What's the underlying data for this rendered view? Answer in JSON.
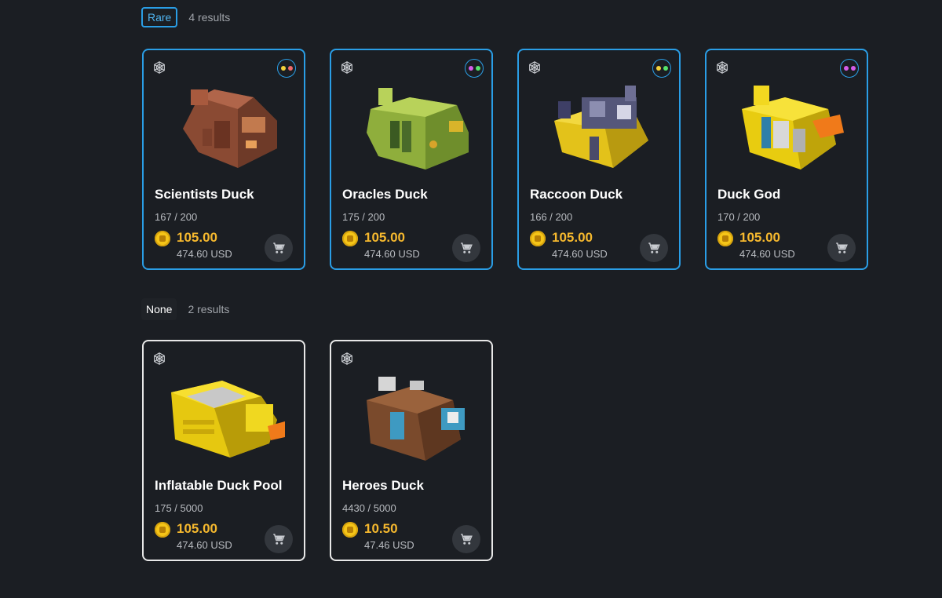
{
  "sections": [
    {
      "tag": "Rare",
      "count": "4 results",
      "cards": [
        {
          "name": "Scientists Duck",
          "supply": "167 / 200",
          "price": "105.00",
          "usd": "474.60 USD",
          "dots": [
            "#f3d23a",
            "#f06a6a"
          ],
          "icon": "scientists-duck-art"
        },
        {
          "name": "Oracles Duck",
          "supply": "175 / 200",
          "price": "105.00",
          "usd": "474.60 USD",
          "dots": [
            "#d65ce8",
            "#56e56b"
          ],
          "icon": "oracles-duck-art"
        },
        {
          "name": "Raccoon Duck",
          "supply": "166 / 200",
          "price": "105.00",
          "usd": "474.60 USD",
          "dots": [
            "#f3d23a",
            "#56e56b"
          ],
          "icon": "raccoon-duck-art"
        },
        {
          "name": "Duck God",
          "supply": "170 / 200",
          "price": "105.00",
          "usd": "474.60 USD",
          "dots": [
            "#d65ce8",
            "#d65ce8"
          ],
          "icon": "duck-god-art"
        }
      ]
    },
    {
      "tag": "None",
      "count": "2 results",
      "cards": [
        {
          "name": "Inflatable Duck Pool",
          "supply": "175 / 5000",
          "price": "105.00",
          "usd": "474.60 USD",
          "icon": "inflatable-duck-pool-art"
        },
        {
          "name": "Heroes Duck",
          "supply": "4430 / 5000",
          "price": "10.50",
          "usd": "47.46 USD",
          "icon": "heroes-duck-art"
        }
      ]
    }
  ],
  "icons": {
    "web": "web-globe-icon",
    "cart": "cart-icon",
    "coin": "egg-coin-icon"
  },
  "colors": {
    "accent": "#2a9ee6",
    "price": "#f5b82e",
    "background": "#1b1e23"
  }
}
